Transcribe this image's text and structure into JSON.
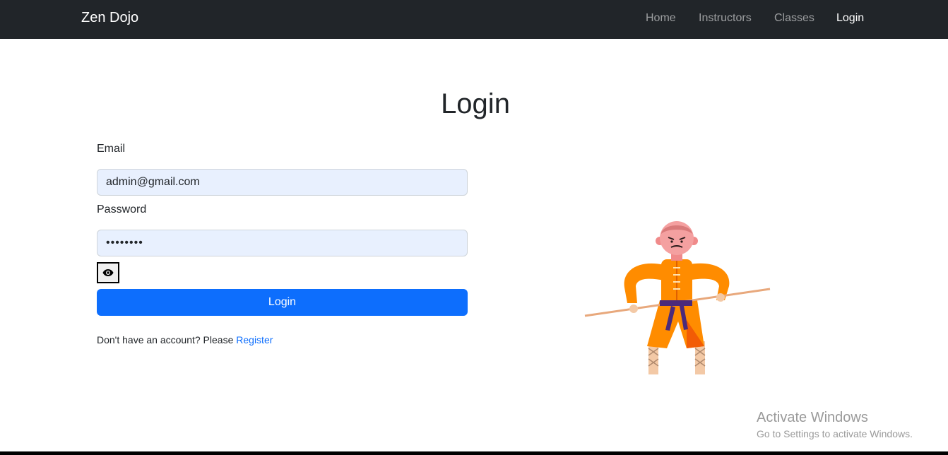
{
  "navbar": {
    "brand": "Zen Dojo",
    "links": [
      "Home",
      "Instructors",
      "Classes",
      "Login"
    ],
    "active_link": "Login"
  },
  "page": {
    "title": "Login"
  },
  "form": {
    "email_label": "Email",
    "email_value": "admin@gmail.com",
    "password_label": "Password",
    "password_value": "••••••••",
    "toggle_icon": "eye-icon",
    "submit_label": "Login",
    "register_prompt": "Don't have an account? Please ",
    "register_link": "Register"
  },
  "watermark": {
    "title": "Activate Windows",
    "subtitle": "Go to Settings to activate Windows."
  },
  "colors": {
    "navbar_bg": "#212529",
    "primary": "#0d6efd",
    "autofill_bg": "#e8f0fe",
    "robe": "#ff8c00",
    "belt": "#4b2a7b"
  }
}
